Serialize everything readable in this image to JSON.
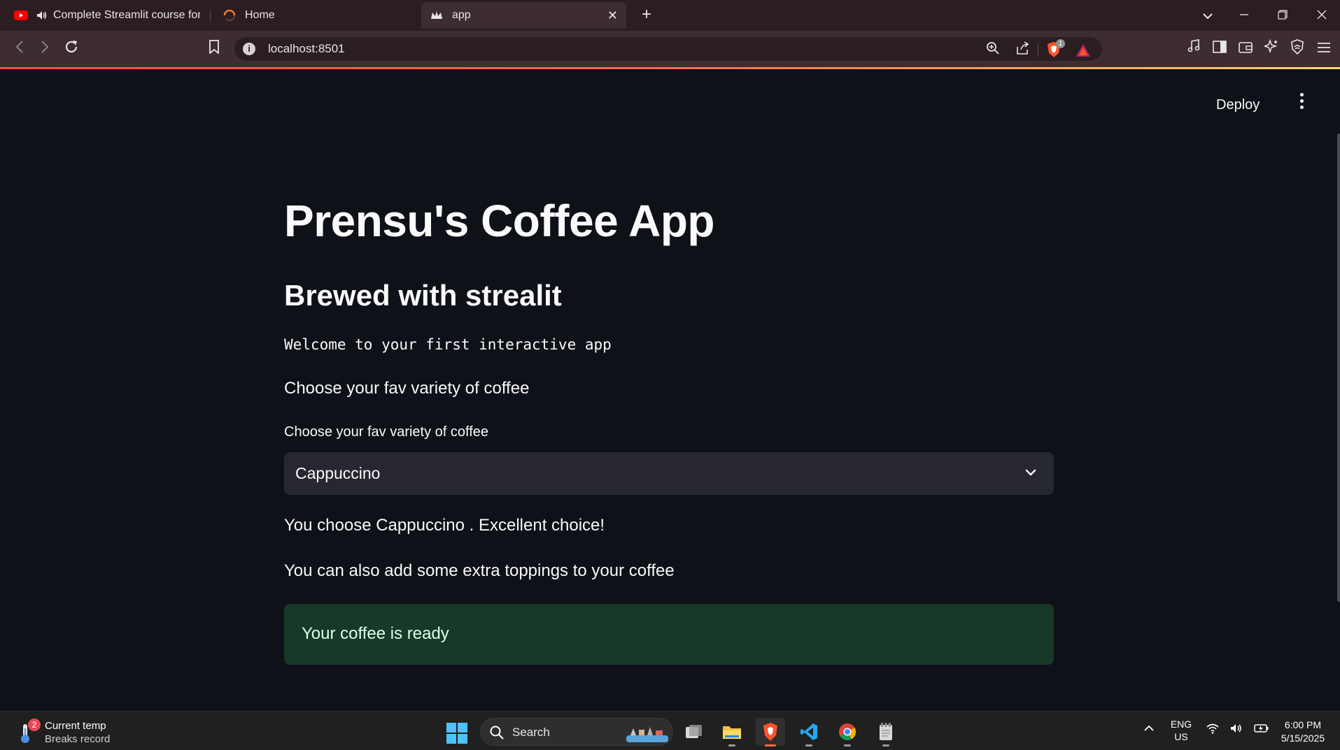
{
  "browser": {
    "tabs": [
      {
        "title": "Complete Streamlit course for p",
        "favicon": "youtube-icon",
        "audio": true
      },
      {
        "title": "Home",
        "favicon": "loading-spinner-icon"
      },
      {
        "title": "app",
        "favicon": "streamlit-crown-icon",
        "active": true
      }
    ],
    "address": "localhost:8501",
    "brave_shield_count": "1"
  },
  "app": {
    "deploy_label": "Deploy",
    "title": "Prensu's Coffee App",
    "subtitle": "Brewed with strealit",
    "welcome_code": "Welcome to your first interactive app",
    "choose_text": "Choose your fav variety of coffee",
    "select": {
      "label": "Choose your fav variety of coffee",
      "value": "Cappuccino"
    },
    "choice_text": "You choose Cappuccino . Excellent choice!",
    "toppings_text": "You can also add some extra toppings to your coffee",
    "success_message": "Your coffee is ready",
    "accent_color": "#ff4b4b",
    "success_bg": "#173928"
  },
  "taskbar": {
    "weather_title": "Current temp",
    "weather_sub": "Breaks record",
    "weather_badge": "2",
    "search_label": "Search",
    "lang_top": "ENG",
    "lang_bottom": "US",
    "time": "6:00 PM",
    "date": "5/15/2025"
  }
}
